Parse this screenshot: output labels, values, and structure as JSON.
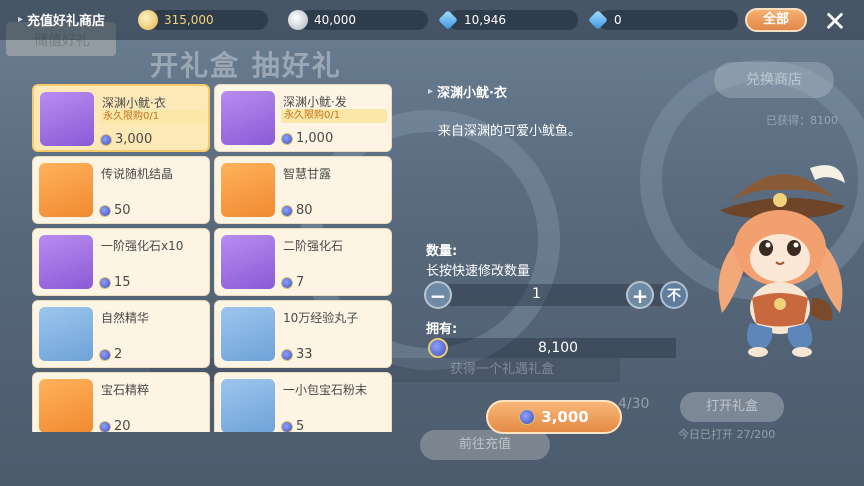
{
  "colors": {
    "accent": "#e48a46",
    "selected_bg": "#fde9b8",
    "limit_text": "#c2721e",
    "card_bg": "#fdf4e3"
  },
  "header": {
    "title": "充值好礼商店",
    "currencies": [
      {
        "icon": "gold-coin-icon",
        "value": "315,000",
        "color": "#f3d37c"
      },
      {
        "icon": "silver-coin-icon",
        "value": "40,000",
        "color": "#d6dde6"
      },
      {
        "icon": "blue-diamond-plus-icon",
        "value": "10,946",
        "color": "#5fb8f0"
      },
      {
        "icon": "blue-diamond-icon",
        "value": "0",
        "color": "#5fb8f0"
      }
    ],
    "filter_label": "全部",
    "close_label": "✕"
  },
  "background": {
    "tab_label": "储值好礼",
    "title": "开礼盒 抽好礼",
    "right_button": "兑换商店",
    "right_stat": "已获得：8100",
    "strip_text": "获得一个礼遇礼盒",
    "open_count": "4/30",
    "open_button": "打开礼盒",
    "today_text": "今日已打开 27/200",
    "bottom_button": "前往充值"
  },
  "items": [
    {
      "name": "深渊小鱿·衣",
      "limit": "永久限购0/1",
      "price": "3,000",
      "thumb": "purple",
      "icon": "squid-outfit-icon",
      "selected": true
    },
    {
      "name": "深渊小鱿·发",
      "limit": "永久限购0/1",
      "price": "1,000",
      "thumb": "purple",
      "icon": "squid-hair-icon",
      "selected": false
    },
    {
      "name": "传说随机结晶",
      "limit": "",
      "price": "50",
      "thumb": "orange",
      "icon": "crystal-icon",
      "selected": false
    },
    {
      "name": "智慧甘露",
      "limit": "",
      "price": "80",
      "thumb": "orange",
      "icon": "nectar-icon",
      "selected": false
    },
    {
      "name": "一阶强化石x10",
      "limit": "",
      "price": "15",
      "thumb": "purple",
      "icon": "yellow-gem-icon",
      "selected": false
    },
    {
      "name": "二阶强化石",
      "limit": "",
      "price": "7",
      "thumb": "purple",
      "icon": "green-gem-icon",
      "selected": false
    },
    {
      "name": "自然精华",
      "limit": "",
      "price": "2",
      "thumb": "blue",
      "icon": "yin-yang-orb-icon",
      "selected": false
    },
    {
      "name": "10万经验丸子",
      "limit": "",
      "price": "33",
      "thumb": "blue",
      "icon": "exp-dumpling-icon",
      "selected": false
    },
    {
      "name": "宝石精粹",
      "limit": "",
      "price": "20",
      "thumb": "orange",
      "icon": "gem-essence-icon",
      "selected": false
    },
    {
      "name": "一小包宝石粉末",
      "limit": "",
      "price": "5",
      "thumb": "blue",
      "icon": "gem-powder-icon",
      "selected": false
    }
  ],
  "detail": {
    "name": "深渊小鱿·衣",
    "description": "来自深渊的可爱小鱿鱼。",
    "quantity_label": "数量:",
    "quantity_hint": "长按快速修改数量",
    "quantity": "1",
    "minus_label": "−",
    "plus_label": "+",
    "max_label": "不",
    "owned_label": "拥有:",
    "owned_value": "8,100"
  },
  "buy_button": {
    "price": "3,000"
  }
}
